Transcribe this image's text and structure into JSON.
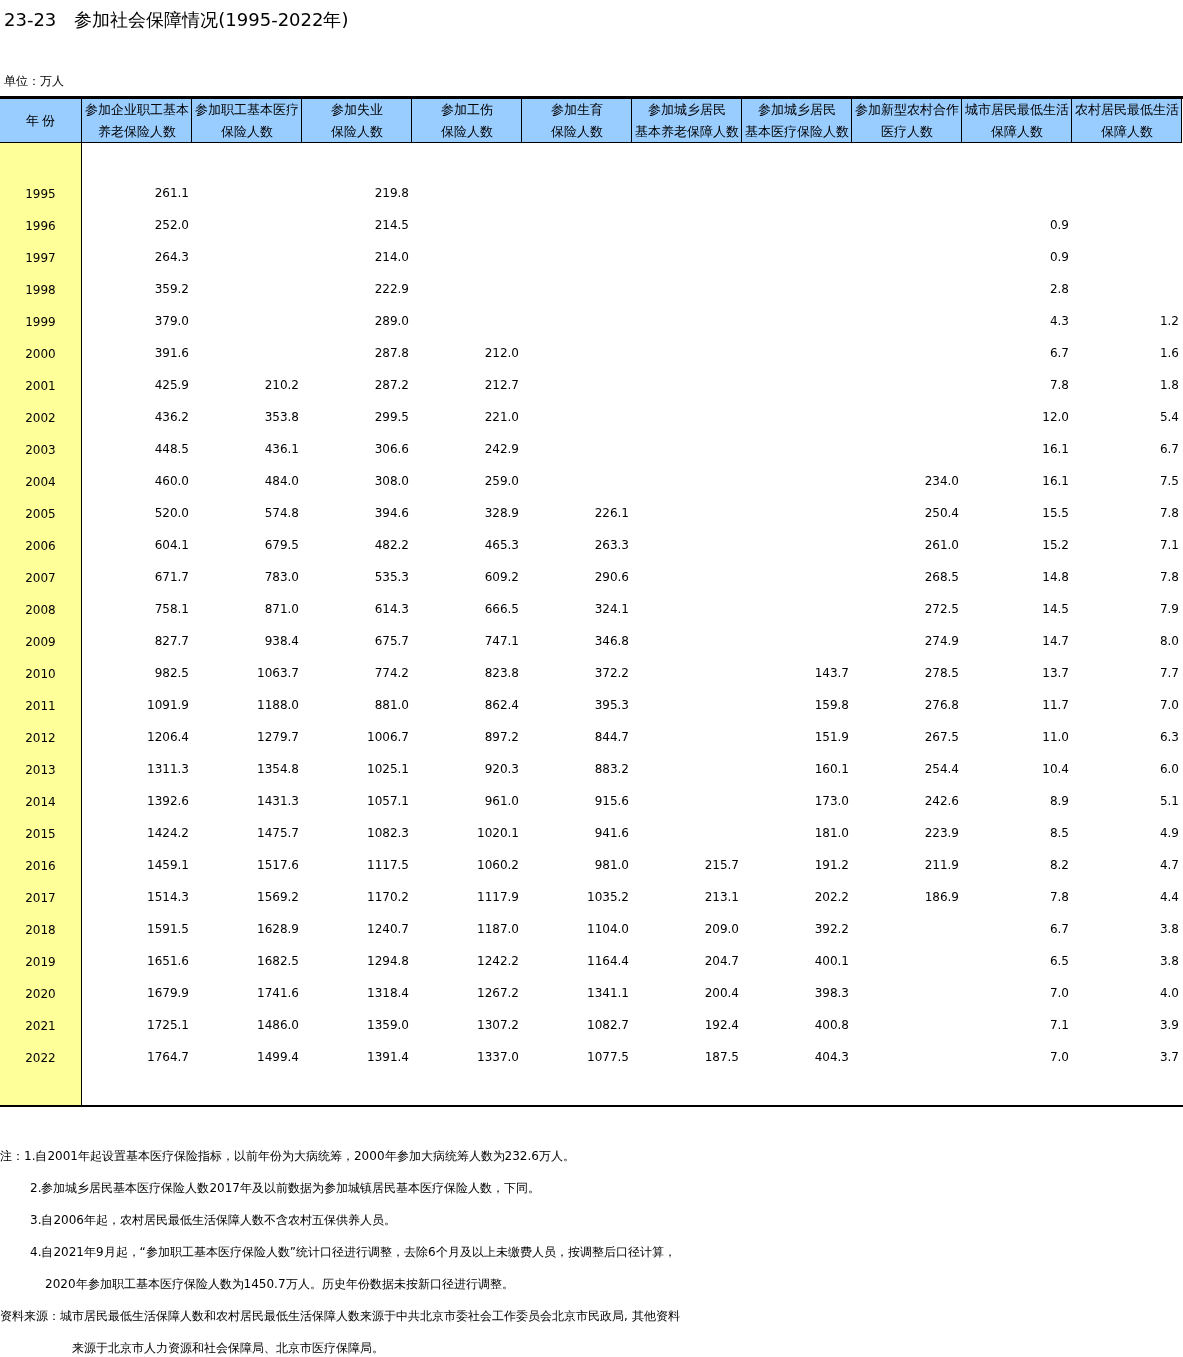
{
  "title": "23-23　参加社会保障情况(1995-2022年)",
  "unit": "单位：万人",
  "table": {
    "columns": [
      {
        "lines": [
          "年 份"
        ]
      },
      {
        "lines": [
          "参加企业职工基本",
          "养老保险人数"
        ]
      },
      {
        "lines": [
          "参加职工基本医疗",
          "保险人数"
        ]
      },
      {
        "lines": [
          "参加失业",
          "保险人数"
        ]
      },
      {
        "lines": [
          "参加工伤",
          "保险人数"
        ]
      },
      {
        "lines": [
          "参加生育",
          "保险人数"
        ]
      },
      {
        "lines": [
          "参加城乡居民",
          "基本养老保障人数"
        ]
      },
      {
        "lines": [
          "参加城乡居民",
          "基本医疗保险人数"
        ]
      },
      {
        "lines": [
          "参加新型农村合作",
          "医疗人数"
        ]
      },
      {
        "lines": [
          "城市居民最低生活",
          "保障人数"
        ]
      },
      {
        "lines": [
          "农村居民最低生活",
          "保障人数"
        ]
      }
    ],
    "rows": [
      {
        "year": "1995",
        "pension": "261.1",
        "unemployment": "219.8"
      },
      {
        "year": "1996",
        "pension": "252.0",
        "unemployment": "214.5",
        "urban_minimum": "0.9"
      },
      {
        "year": "1997",
        "pension": "264.3",
        "unemployment": "214.0",
        "urban_minimum": "0.9"
      },
      {
        "year": "1998",
        "pension": "359.2",
        "unemployment": "222.9",
        "urban_minimum": "2.8"
      },
      {
        "year": "1999",
        "pension": "379.0",
        "unemployment": "289.0",
        "urban_minimum": "4.3",
        "rural_minimum": "1.2"
      },
      {
        "year": "2000",
        "pension": "391.6",
        "unemployment": "287.8",
        "injury": "212.0",
        "urban_minimum": "6.7",
        "rural_minimum": "1.6"
      },
      {
        "year": "2001",
        "pension": "425.9",
        "medical": "210.2",
        "unemployment": "287.2",
        "injury": "212.7",
        "urban_minimum": "7.8",
        "rural_minimum": "1.8"
      },
      {
        "year": "2002",
        "pension": "436.2",
        "medical": "353.8",
        "unemployment": "299.5",
        "injury": "221.0",
        "urban_minimum": "12.0",
        "rural_minimum": "5.4"
      },
      {
        "year": "2003",
        "pension": "448.5",
        "medical": "436.1",
        "unemployment": "306.6",
        "injury": "242.9",
        "urban_minimum": "16.1",
        "rural_minimum": "6.7"
      },
      {
        "year": "2004",
        "pension": "460.0",
        "medical": "484.0",
        "unemployment": "308.0",
        "injury": "259.0",
        "rural_coop": "234.0",
        "urban_minimum": "16.1",
        "rural_minimum": "7.5"
      },
      {
        "year": "2005",
        "pension": "520.0",
        "medical": "574.8",
        "unemployment": "394.6",
        "injury": "328.9",
        "maternity": "226.1",
        "rural_coop": "250.4",
        "urban_minimum": "15.5",
        "rural_minimum": "7.8"
      },
      {
        "year": "2006",
        "pension": "604.1",
        "medical": "679.5",
        "unemployment": "482.2",
        "injury": "465.3",
        "maternity": "263.3",
        "rural_coop": "261.0",
        "urban_minimum": "15.2",
        "rural_minimum": "7.1"
      },
      {
        "year": "2007",
        "pension": "671.7",
        "medical": "783.0",
        "unemployment": "535.3",
        "injury": "609.2",
        "maternity": "290.6",
        "rural_coop": "268.5",
        "urban_minimum": "14.8",
        "rural_minimum": "7.8"
      },
      {
        "year": "2008",
        "pension": "758.1",
        "medical": "871.0",
        "unemployment": "614.3",
        "injury": "666.5",
        "maternity": "324.1",
        "rural_coop": "272.5",
        "urban_minimum": "14.5",
        "rural_minimum": "7.9"
      },
      {
        "year": "2009",
        "pension": "827.7",
        "medical": "938.4",
        "unemployment": "675.7",
        "injury": "747.1",
        "maternity": "346.8",
        "rural_coop": "274.9",
        "urban_minimum": "14.7",
        "rural_minimum": "8.0"
      },
      {
        "year": "2010",
        "pension": "982.5",
        "medical": "1063.7",
        "unemployment": "774.2",
        "injury": "823.8",
        "maternity": "372.2",
        "resident_medical": "143.7",
        "rural_coop": "278.5",
        "urban_minimum": "13.7",
        "rural_minimum": "7.7"
      },
      {
        "year": "2011",
        "pension": "1091.9",
        "medical": "1188.0",
        "unemployment": "881.0",
        "injury": "862.4",
        "maternity": "395.3",
        "resident_medical": "159.8",
        "rural_coop": "276.8",
        "urban_minimum": "11.7",
        "rural_minimum": "7.0"
      },
      {
        "year": "2012",
        "pension": "1206.4",
        "medical": "1279.7",
        "unemployment": "1006.7",
        "injury": "897.2",
        "maternity": "844.7",
        "resident_medical": "151.9",
        "rural_coop": "267.5",
        "urban_minimum": "11.0",
        "rural_minimum": "6.3"
      },
      {
        "year": "2013",
        "pension": "1311.3",
        "medical": "1354.8",
        "unemployment": "1025.1",
        "injury": "920.3",
        "maternity": "883.2",
        "resident_medical": "160.1",
        "rural_coop": "254.4",
        "urban_minimum": "10.4",
        "rural_minimum": "6.0"
      },
      {
        "year": "2014",
        "pension": "1392.6",
        "medical": "1431.3",
        "unemployment": "1057.1",
        "injury": "961.0",
        "maternity": "915.6",
        "resident_medical": "173.0",
        "rural_coop": "242.6",
        "urban_minimum": "8.9",
        "rural_minimum": "5.1"
      },
      {
        "year": "2015",
        "pension": "1424.2",
        "medical": "1475.7",
        "unemployment": "1082.3",
        "injury": "1020.1",
        "maternity": "941.6",
        "resident_medical": "181.0",
        "rural_coop": "223.9",
        "urban_minimum": "8.5",
        "rural_minimum": "4.9"
      },
      {
        "year": "2016",
        "pension": "1459.1",
        "medical": "1517.6",
        "unemployment": "1117.5",
        "injury": "1060.2",
        "maternity": "981.0",
        "resident_pension": "215.7",
        "resident_medical": "191.2",
        "rural_coop": "211.9",
        "urban_minimum": "8.2",
        "rural_minimum": "4.7"
      },
      {
        "year": "2017",
        "pension": "1514.3",
        "medical": "1569.2",
        "unemployment": "1170.2",
        "injury": "1117.9",
        "maternity": "1035.2",
        "resident_pension": "213.1",
        "resident_medical": "202.2",
        "rural_coop": "186.9",
        "urban_minimum": "7.8",
        "rural_minimum": "4.4"
      },
      {
        "year": "2018",
        "pension": "1591.5",
        "medical": "1628.9",
        "unemployment": "1240.7",
        "injury": "1187.0",
        "maternity": "1104.0",
        "resident_pension": "209.0",
        "resident_medical": "392.2",
        "urban_minimum": "6.7",
        "rural_minimum": "3.8"
      },
      {
        "year": "2019",
        "pension": "1651.6",
        "medical": "1682.5",
        "unemployment": "1294.8",
        "injury": "1242.2",
        "maternity": "1164.4",
        "resident_pension": "204.7",
        "resident_medical": "400.1",
        "urban_minimum": "6.5",
        "rural_minimum": "3.8"
      },
      {
        "year": "2020",
        "pension": "1679.9",
        "medical": "1741.6",
        "unemployment": "1318.4",
        "injury": "1267.2",
        "maternity": "1341.1",
        "resident_pension": "200.4",
        "resident_medical": "398.3",
        "urban_minimum": "7.0",
        "rural_minimum": "4.0"
      },
      {
        "year": "2021",
        "pension": "1725.1",
        "medical": "1486.0",
        "unemployment": "1359.0",
        "injury": "1307.2",
        "maternity": "1082.7",
        "resident_pension": "192.4",
        "resident_medical": "400.8",
        "urban_minimum": "7.1",
        "rural_minimum": "3.9"
      },
      {
        "year": "2022",
        "pension": "1764.7",
        "medical": "1499.4",
        "unemployment": "1391.4",
        "injury": "1337.0",
        "maternity": "1077.5",
        "resident_pension": "187.5",
        "resident_medical": "404.3",
        "urban_minimum": "7.0",
        "rural_minimum": "3.7"
      }
    ]
  },
  "notes": [
    {
      "kind": "first",
      "label": "注：",
      "text": "1.自2001年起设置基本医疗保险指标，以前年份为大病统筹，2000年参加大病统筹人数为232.6万人。"
    },
    {
      "kind": "item",
      "text": "2.参加城乡居民基本医疗保险人数2017年及以前数据为参加城镇居民基本医疗保险人数，下同。"
    },
    {
      "kind": "item",
      "text": "3.自2006年起，农村居民最低生活保障人数不含农村五保供养人员。"
    },
    {
      "kind": "item",
      "text": "4.自2021年9月起，“参加职工基本医疗保险人数”统计口径进行调整，去除6个月及以上未缴费人员，按调整后口径计算，"
    },
    {
      "kind": "continuation",
      "text": "2020年参加职工基本医疗保险人数为1450.7万人。历史年份数据未按新口径进行调整。"
    }
  ],
  "source": {
    "label": "资料来源：",
    "lines": [
      "城市居民最低生活保障人数和农村居民最低生活保障人数来源于中共北京市委社会工作委员会北京市民政局, 其他资料",
      "来源于北京市人力资源和社会保障局、北京市医疗保障局。"
    ]
  }
}
